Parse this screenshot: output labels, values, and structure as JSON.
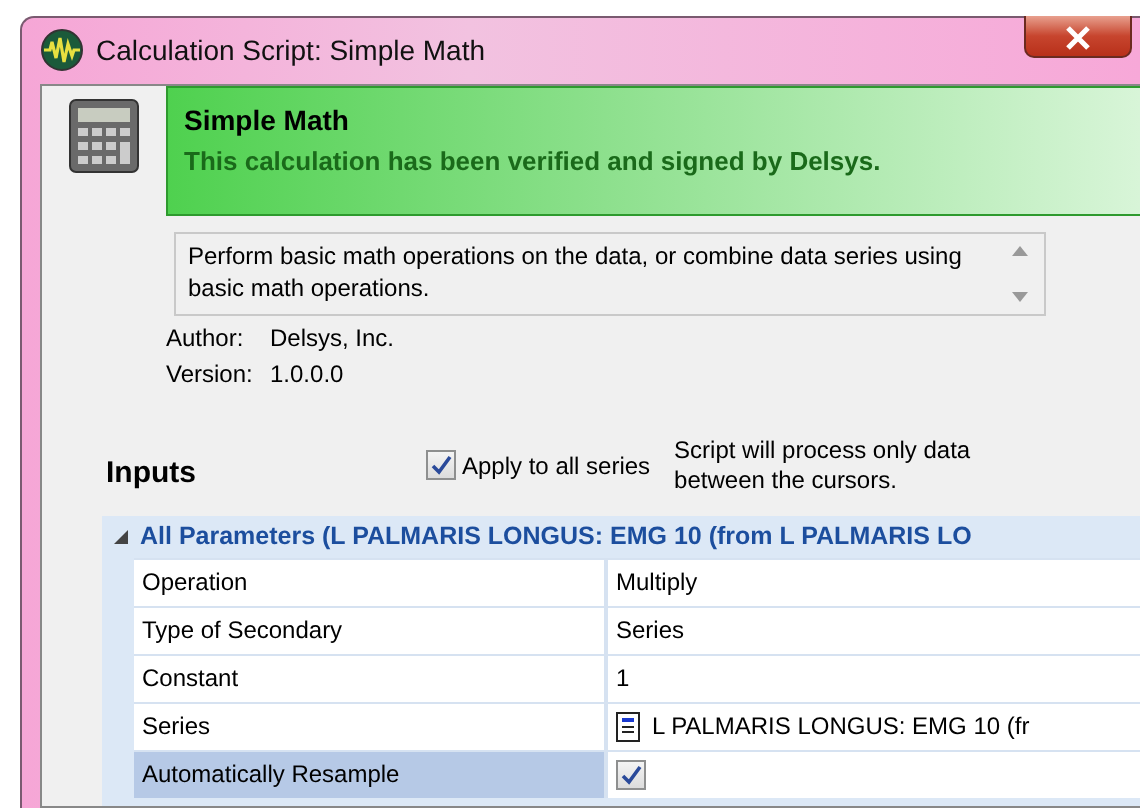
{
  "window": {
    "title": "Calculation Script: Simple Math"
  },
  "header": {
    "title": "Simple Math",
    "status": "This calculation has been verified and signed by Delsys."
  },
  "description": "Perform basic math operations on the data, or combine data series using basic math operations.",
  "author": {
    "label": "Author:",
    "value": "Delsys, Inc."
  },
  "version": {
    "label": "Version:",
    "value": "1.0.0.0"
  },
  "inputs": {
    "title": "Inputs",
    "apply_all": {
      "label": "Apply to all series",
      "checked": true
    },
    "note": "Script will process only data between the cursors."
  },
  "grid": {
    "group": {
      "label": "All Parameters (L PALMARIS LONGUS: EMG 10 (from L PALMARIS LO",
      "expanded": true
    },
    "rows": [
      {
        "name": "Operation",
        "kind": "text",
        "value": "Multiply",
        "selected": false
      },
      {
        "name": "Type of Secondary",
        "kind": "text",
        "value": "Series",
        "selected": false
      },
      {
        "name": "Constant",
        "kind": "text",
        "value": "1",
        "selected": false
      },
      {
        "name": "Series",
        "kind": "series",
        "value": "L PALMARIS LONGUS: EMG 10 (fr",
        "selected": false
      },
      {
        "name": "Automatically Resample",
        "kind": "checkbox",
        "checked": true,
        "selected": true
      }
    ]
  }
}
